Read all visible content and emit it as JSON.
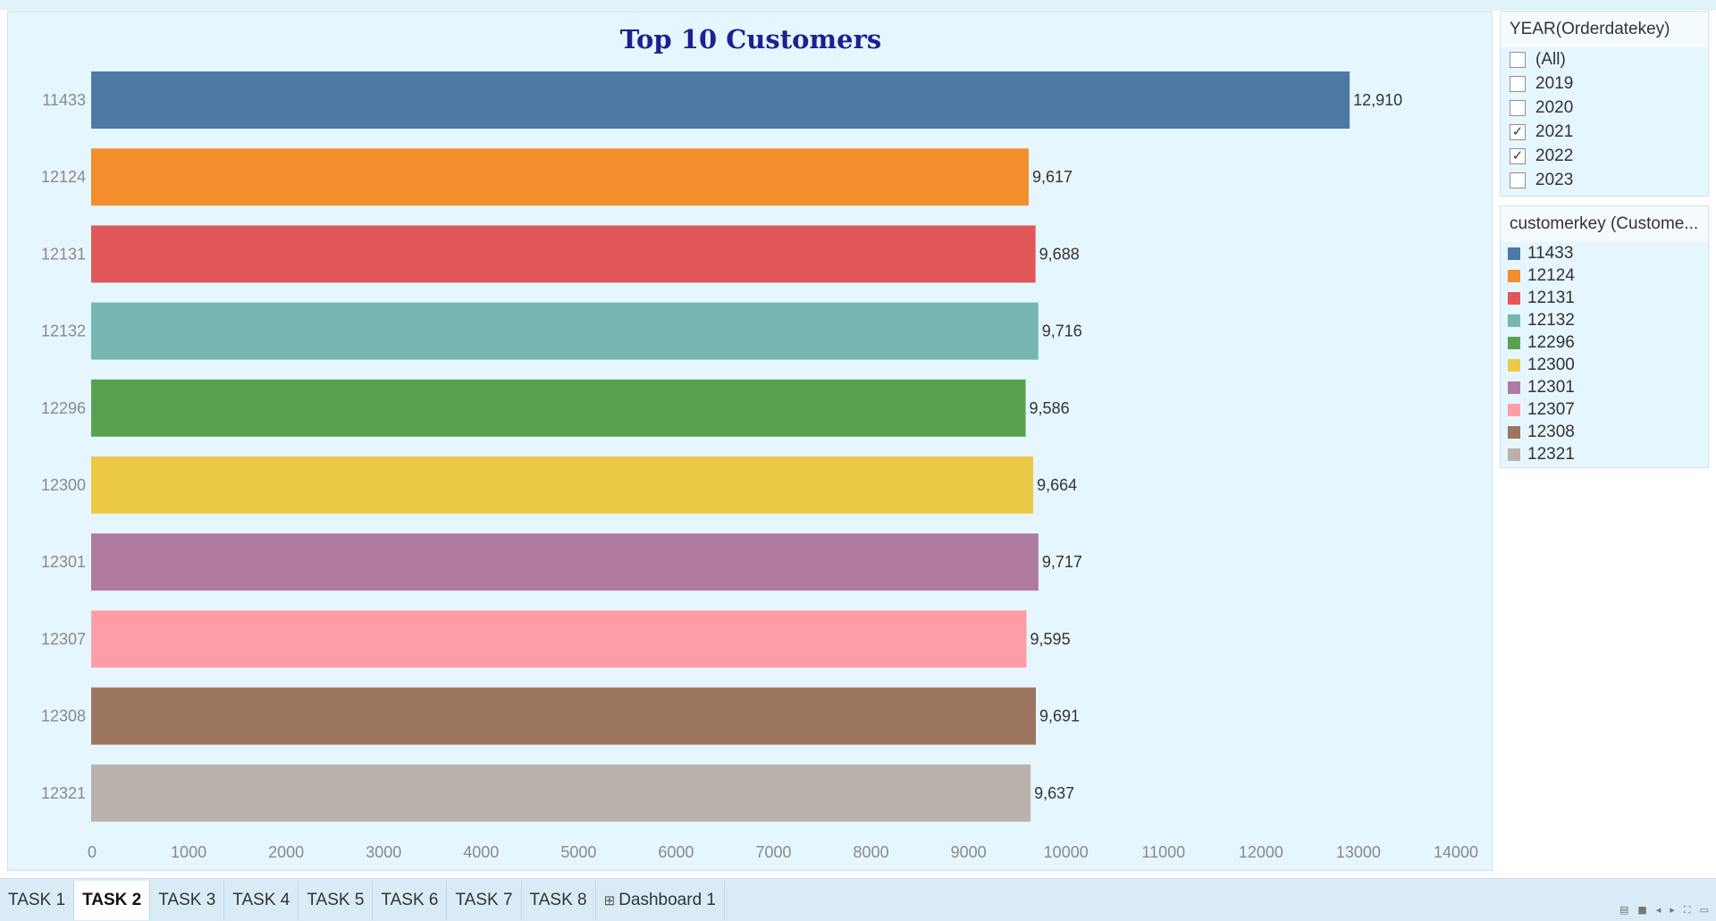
{
  "chart_data": {
    "type": "bar",
    "orientation": "horizontal",
    "title": "Top 10 Customers",
    "categories": [
      "11433",
      "12124",
      "12131",
      "12132",
      "12296",
      "12300",
      "12301",
      "12307",
      "12308",
      "12321"
    ],
    "values": [
      12910,
      9617,
      9688,
      9716,
      9586,
      9664,
      9717,
      9595,
      9691,
      9637
    ],
    "value_labels": [
      "12,910",
      "9,617",
      "9,688",
      "9,716",
      "9,586",
      "9,664",
      "9,717",
      "9,595",
      "9,691",
      "9,637"
    ],
    "colors": [
      "#4e79a7",
      "#f28e2b",
      "#e15759",
      "#76b7b2",
      "#59a14f",
      "#edc948",
      "#b07aa1",
      "#ff9da7",
      "#9c755f",
      "#bab0ac"
    ],
    "xlim": [
      0,
      14000
    ],
    "xticks": [
      0,
      1000,
      2000,
      3000,
      4000,
      5000,
      6000,
      7000,
      8000,
      9000,
      10000,
      11000,
      12000,
      13000,
      14000
    ],
    "grid": false,
    "legend": "right"
  },
  "filter": {
    "title": "YEAR(Orderdatekey)",
    "options": [
      {
        "label": "(All)",
        "checked": false
      },
      {
        "label": "2019",
        "checked": false
      },
      {
        "label": "2020",
        "checked": false
      },
      {
        "label": "2021",
        "checked": true
      },
      {
        "label": "2022",
        "checked": true
      },
      {
        "label": "2023",
        "checked": false
      }
    ]
  },
  "legend": {
    "title": "customerkey (Custome...",
    "items": [
      {
        "label": "11433",
        "color": "#4e79a7"
      },
      {
        "label": "12124",
        "color": "#f28e2b"
      },
      {
        "label": "12131",
        "color": "#e15759"
      },
      {
        "label": "12132",
        "color": "#76b7b2"
      },
      {
        "label": "12296",
        "color": "#59a14f"
      },
      {
        "label": "12300",
        "color": "#edc948"
      },
      {
        "label": "12301",
        "color": "#b07aa1"
      },
      {
        "label": "12307",
        "color": "#ff9da7"
      },
      {
        "label": "12308",
        "color": "#9c755f"
      },
      {
        "label": "12321",
        "color": "#bab0ac"
      }
    ]
  },
  "tabs": [
    {
      "label": "TASK 1",
      "active": false,
      "icon": ""
    },
    {
      "label": "TASK 2",
      "active": true,
      "icon": ""
    },
    {
      "label": "TASK 3",
      "active": false,
      "icon": ""
    },
    {
      "label": "TASK 4",
      "active": false,
      "icon": ""
    },
    {
      "label": "TASK 5",
      "active": false,
      "icon": ""
    },
    {
      "label": "TASK 6",
      "active": false,
      "icon": ""
    },
    {
      "label": "TASK 7",
      "active": false,
      "icon": ""
    },
    {
      "label": "TASK 8",
      "active": false,
      "icon": ""
    },
    {
      "label": "Dashboard 1",
      "active": false,
      "icon": "dashboard-icon"
    }
  ],
  "status_icons": [
    "grid-view-icon",
    "single-view-icon",
    "prev-icon",
    "next-icon",
    "fullscreen-icon",
    "present-icon"
  ]
}
